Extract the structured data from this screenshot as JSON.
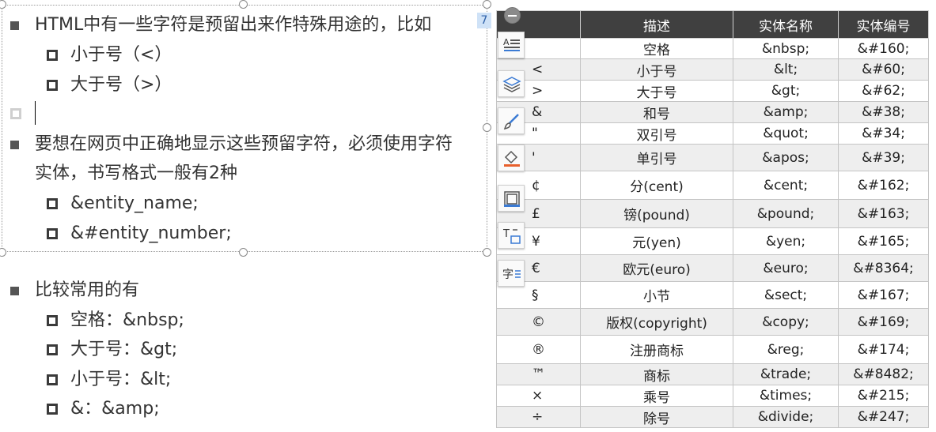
{
  "slide": {
    "block1": {
      "heading": "HTML中有一些字符是预留出来作特殊用途的，比如",
      "items": [
        "小于号（<）",
        "大于号（>）"
      ]
    },
    "block2": {
      "heading_line1": "要想在网页中正确地显示这些预留字符，必须使用字符",
      "heading_line2": "实体，书写格式一般有2种",
      "items": [
        "&entity_name;",
        "&#entity_number;"
      ]
    },
    "block3": {
      "heading": "比较常用的有",
      "items": [
        "空格：&nbsp;",
        "大于号：&gt;",
        "小于号：&lt;",
        "&：&amp;"
      ]
    },
    "slide_number_badge": "7"
  },
  "table": {
    "headers": [
      "",
      "描述",
      "实体名称",
      "实体编号"
    ],
    "rows": [
      [
        "",
        "空格",
        "&nbsp;",
        "&#160;"
      ],
      [
        "<",
        "小于号",
        "&lt;",
        "&#60;"
      ],
      [
        ">",
        "大于号",
        "&gt;",
        "&#62;"
      ],
      [
        "&",
        "和号",
        "&amp;",
        "&#38;"
      ],
      [
        "\"",
        "双引号",
        "&quot;",
        "&#34;"
      ],
      [
        "'",
        "单引号",
        "&apos;",
        "&#39;"
      ],
      [
        "¢",
        "分(cent)",
        "&cent;",
        "&#162;"
      ],
      [
        "£",
        "镑(pound)",
        "&pound;",
        "&#163;"
      ],
      [
        "¥",
        "元(yen)",
        "&yen;",
        "&#165;"
      ],
      [
        "€",
        "欧元(euro)",
        "&euro;",
        "&#8364;"
      ],
      [
        "§",
        "小节",
        "&sect;",
        "&#167;"
      ],
      [
        "©",
        "版权(copyright)",
        "&copy;",
        "&#169;"
      ],
      [
        "®",
        "注册商标",
        "&reg;",
        "&#174;"
      ],
      [
        "™",
        "商标",
        "&trade;",
        "&#8482;"
      ],
      [
        "×",
        "乘号",
        "&times;",
        "&#215;"
      ],
      [
        "÷",
        "除号",
        "&divide;",
        "&#247;"
      ]
    ]
  },
  "toolbar": {
    "icons": [
      "text-align-icon",
      "layers-icon",
      "brush-icon",
      "fill-icon",
      "border-icon",
      "text-box-icon",
      "char-spacing-icon"
    ]
  },
  "colors": {
    "header_bg": "#404040",
    "alt_row_bg": "#eeeeee",
    "accent_orange": "#e8602c",
    "accent_blue": "#3b7bd4"
  }
}
